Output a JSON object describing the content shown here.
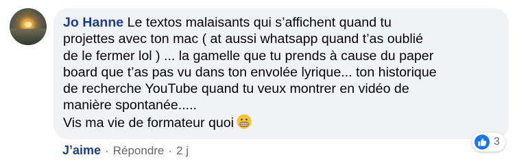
{
  "comment": {
    "author": "Jo Hanne",
    "text_lines": [
      "Le textos malaisants qui s’affichent quand tu",
      "projettes avec ton mac ( at aussi whatsapp quand t’as oublié",
      "de le fermer lol ) ... la gamelle que tu prends à cause du paper",
      "board que t’as pas vu dans ton envolée lyrique... ton historique",
      "de recherche YouTube quand tu veux montrer en vidéo de",
      "manière spontanée.....",
      "Vis ma vie de formateur quoi"
    ],
    "emoji": "grimacing-face-icon"
  },
  "actions": {
    "like_label": "J’aime",
    "separator": "·",
    "reply_label": "Répondre",
    "time": "2 j"
  },
  "reactions": {
    "icon": "thumbs-up-icon",
    "count": "3",
    "color": "#1877f2"
  }
}
